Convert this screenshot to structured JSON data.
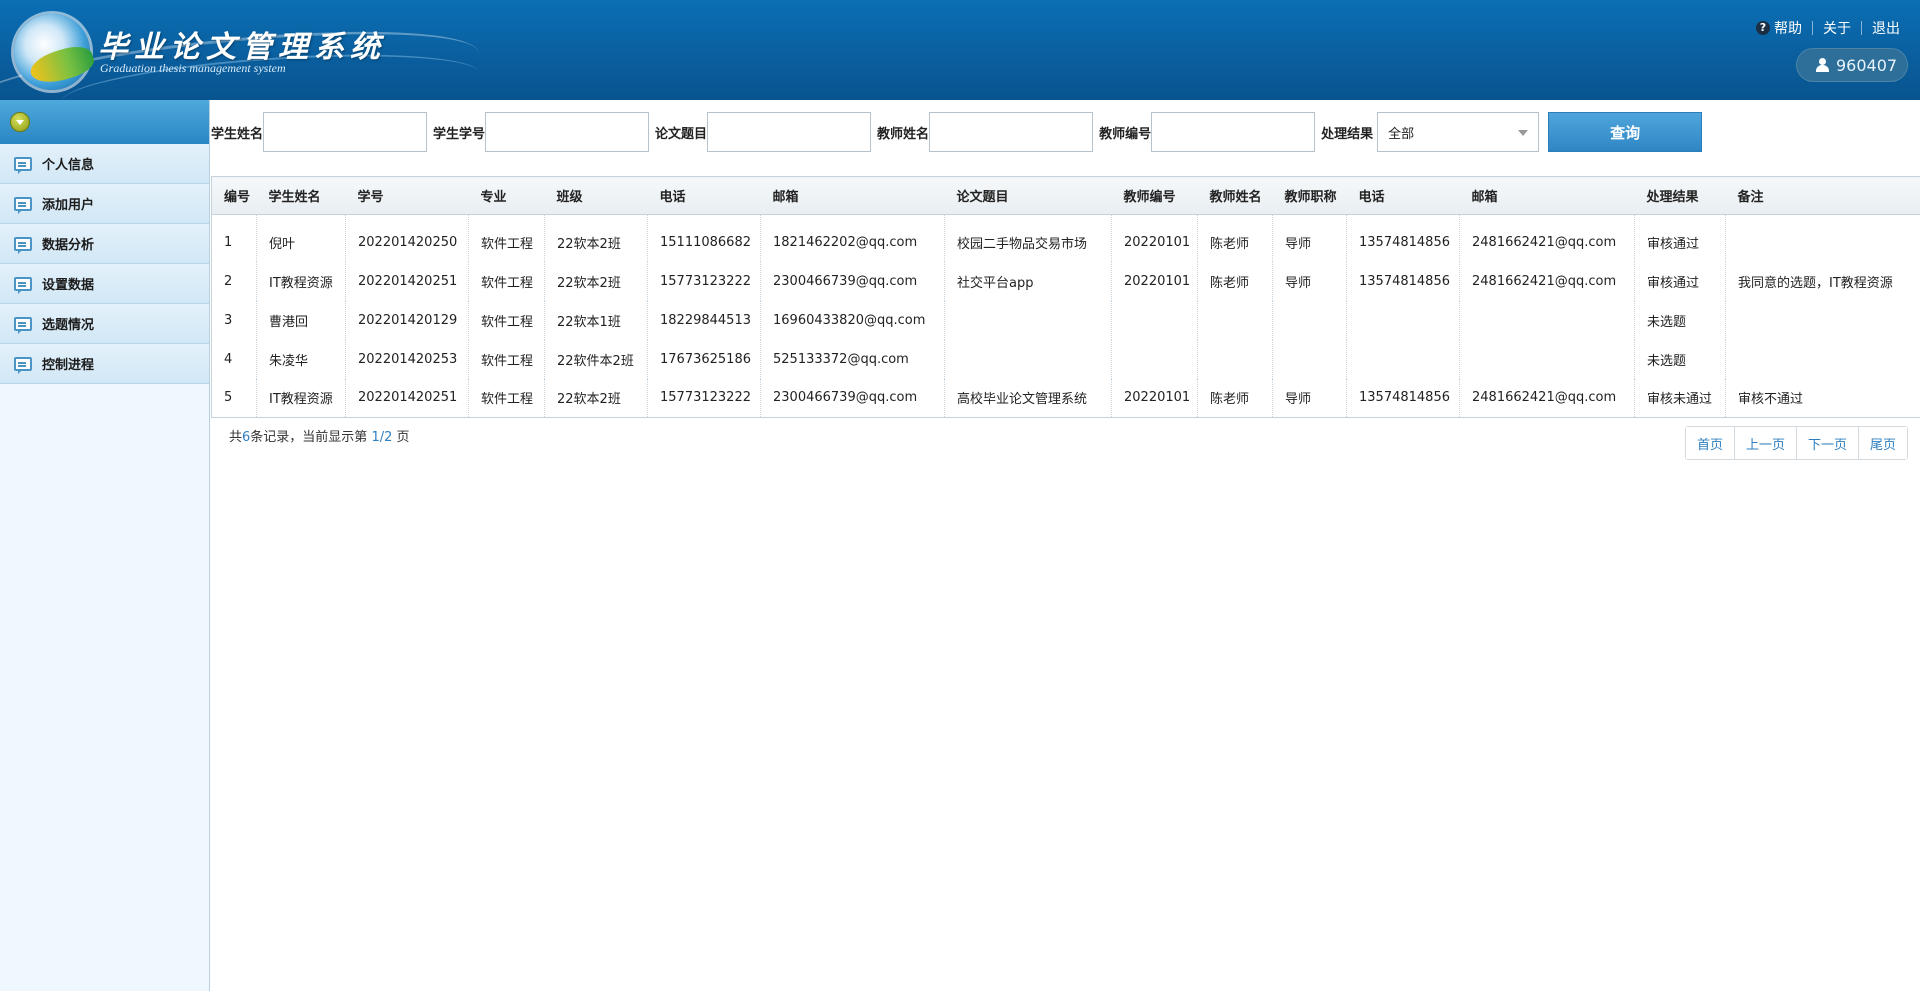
{
  "header": {
    "title": "毕业论文管理系统",
    "subtitle": "Graduation thesis management system",
    "links": {
      "help": "帮助",
      "about": "关于",
      "logout": "退出"
    },
    "user_id": "960407"
  },
  "sidebar": {
    "items": [
      {
        "label": "个人信息"
      },
      {
        "label": "添加用户"
      },
      {
        "label": "数据分析"
      },
      {
        "label": "设置数据"
      },
      {
        "label": "选题情况"
      },
      {
        "label": "控制进程"
      }
    ]
  },
  "filters": {
    "student_name": "学生姓名",
    "student_no": "学生学号",
    "thesis_title": "论文题目",
    "teacher_name": "教师姓名",
    "teacher_no": "教师编号",
    "result": "处理结果",
    "result_value": "全部",
    "query_button": "查询"
  },
  "table": {
    "headers": [
      "编号",
      "学生姓名",
      "学号",
      "专业",
      "班级",
      "电话",
      "邮箱",
      "论文题目",
      "教师编号",
      "教师姓名",
      "教师职称",
      "电话",
      "邮箱",
      "处理结果",
      "备注"
    ],
    "rows": [
      [
        "1",
        "倪叶",
        "202201420250",
        "软件工程",
        "22软本2班",
        "15111086682",
        "1821462202@qq.com",
        "校园二手物品交易市场",
        "20220101",
        "陈老师",
        "导师",
        "13574814856",
        "2481662421@qq.com",
        "审核通过",
        ""
      ],
      [
        "2",
        "IT教程资源",
        "202201420251",
        "软件工程",
        "22软本2班",
        "15773123222",
        "2300466739@qq.com",
        "社交平台app",
        "20220101",
        "陈老师",
        "导师",
        "13574814856",
        "2481662421@qq.com",
        "审核通过",
        "我同意的选题，IT教程资源"
      ],
      [
        "3",
        "曹港回",
        "202201420129",
        "软件工程",
        "22软本1班",
        "18229844513",
        "16960433820@qq.com",
        "",
        "",
        "",
        "",
        "",
        "",
        "未选题",
        ""
      ],
      [
        "4",
        "朱凌华",
        "202201420253",
        "软件工程",
        "22软件本2班",
        "17673625186",
        "525133372@qq.com",
        "",
        "",
        "",
        "",
        "",
        "",
        "未选题",
        ""
      ],
      [
        "5",
        "IT教程资源",
        "202201420251",
        "软件工程",
        "22软本2班",
        "15773123222",
        "2300466739@qq.com",
        "高校毕业论文管理系统",
        "20220101",
        "陈老师",
        "导师",
        "13574814856",
        "2481662421@qq.com",
        "审核未通过",
        "审核不通过"
      ]
    ]
  },
  "pager": {
    "prefix": "共",
    "total": "6",
    "middle": "条记录，当前显示第 ",
    "page": "1/2",
    "suffix": " 页",
    "first": "首页",
    "prev": "上一页",
    "next": "下一页",
    "last": "尾页"
  }
}
